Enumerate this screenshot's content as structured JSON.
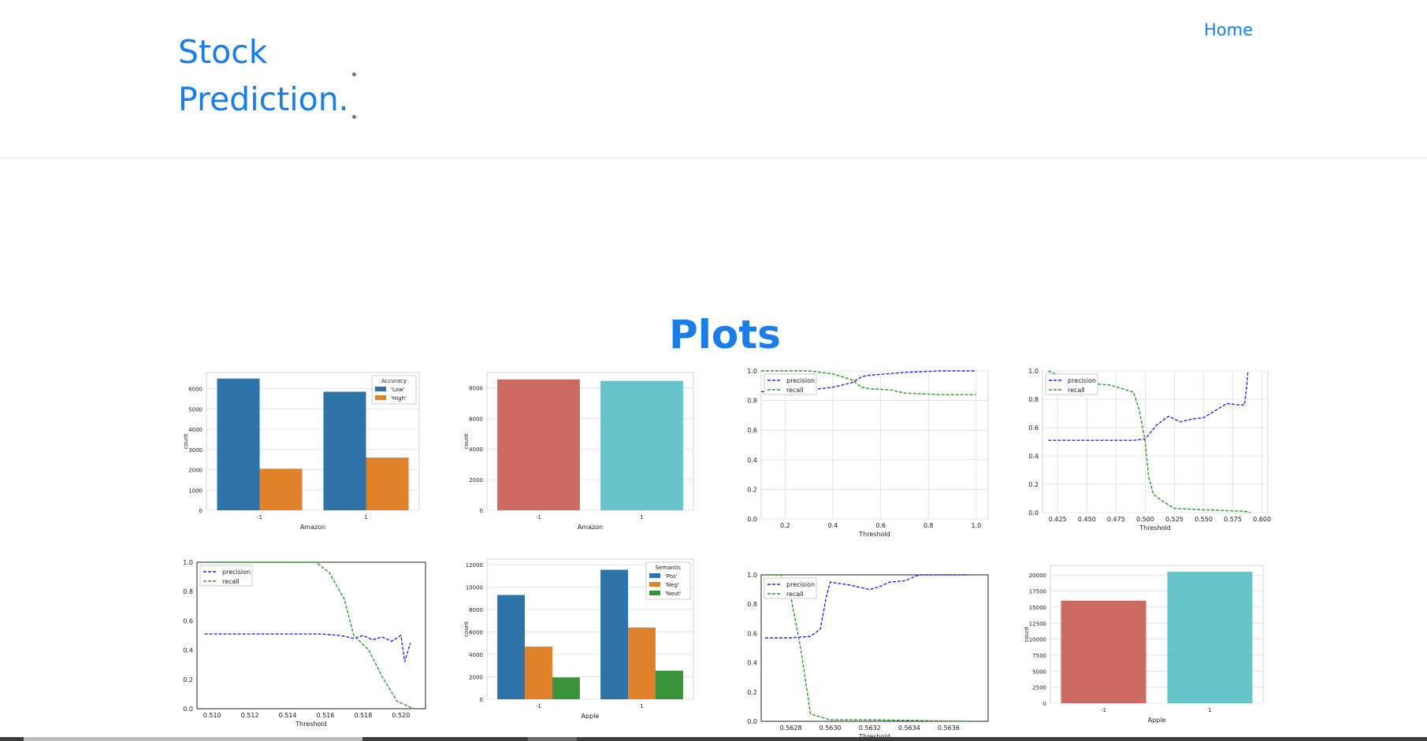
{
  "header": {
    "brand_line1": "Stock",
    "brand_line2": "Prediction.",
    "nav_home": "Home"
  },
  "main": {
    "title": "Plots"
  },
  "colors": {
    "accent": "#1a7de8",
    "blue": "#2f74a8",
    "orange": "#e2812b",
    "green": "#3a923a",
    "red": "#cc6a62",
    "teal": "#68c4cb"
  },
  "chart_data": [
    {
      "type": "bar",
      "xlabel": "Amazon",
      "ylabel": "count",
      "categories": [
        "-1",
        "1"
      ],
      "ylim": [
        0,
        6800
      ],
      "yticks": [
        0,
        1000,
        2000,
        3000,
        4000,
        5000,
        6000
      ],
      "legend": {
        "title": "Accuracy",
        "position": "top-right"
      },
      "series": [
        {
          "name": "'Low'",
          "color": "#2f74a8",
          "values": [
            6500,
            5850
          ]
        },
        {
          "name": "'High'",
          "color": "#e2812b",
          "values": [
            2050,
            2600
          ]
        }
      ]
    },
    {
      "type": "bar",
      "xlabel": "Amazon",
      "ylabel": "count",
      "categories": [
        "-1",
        "1"
      ],
      "ylim": [
        0,
        9000
      ],
      "yticks": [
        0,
        2000,
        4000,
        6000,
        8000
      ],
      "series": [
        {
          "values": [
            8550,
            8450
          ],
          "colors": [
            "#cc6a62",
            "#68c4cb"
          ]
        }
      ]
    },
    {
      "type": "line",
      "xlabel": "Threshold",
      "xlim": [
        0.1,
        1.05
      ],
      "ylim": [
        0,
        1.0
      ],
      "xticks": [
        0.2,
        0.4,
        0.6,
        0.8,
        1.0
      ],
      "yticks": [
        0.0,
        0.2,
        0.4,
        0.6,
        0.8,
        1.0
      ],
      "legend": {
        "position": "top-left"
      },
      "series": [
        {
          "name": "precision",
          "color": "#1f2ee0",
          "x": [
            0.1,
            0.2,
            0.3,
            0.4,
            0.48,
            0.52,
            0.55,
            0.7,
            0.85,
            1.0
          ],
          "y": [
            0.86,
            0.86,
            0.87,
            0.89,
            0.92,
            0.96,
            0.97,
            0.99,
            1.0,
            1.0
          ]
        },
        {
          "name": "recall",
          "color": "#2a9a2a",
          "x": [
            0.1,
            0.2,
            0.3,
            0.4,
            0.48,
            0.52,
            0.55,
            0.65,
            0.7,
            0.85,
            1.0
          ],
          "y": [
            1.0,
            1.0,
            1.0,
            0.98,
            0.94,
            0.89,
            0.88,
            0.87,
            0.85,
            0.84,
            0.84
          ]
        }
      ]
    },
    {
      "type": "line",
      "xlabel": "Threshold",
      "xlim": [
        0.412,
        0.605
      ],
      "ylim": [
        0,
        1.0
      ],
      "xticks": [
        0.425,
        0.45,
        0.475,
        0.5,
        0.525,
        0.55,
        0.575,
        0.6
      ],
      "yticks": [
        0.0,
        0.2,
        0.4,
        0.6,
        0.8,
        1.0
      ],
      "legend": {
        "position": "top-left"
      },
      "series": [
        {
          "name": "precision",
          "color": "#1f2ee0",
          "x": [
            0.417,
            0.45,
            0.49,
            0.5,
            0.51,
            0.52,
            0.53,
            0.54,
            0.55,
            0.56,
            0.57,
            0.58,
            0.585,
            0.587,
            0.588
          ],
          "y": [
            0.51,
            0.51,
            0.51,
            0.52,
            0.62,
            0.68,
            0.64,
            0.66,
            0.67,
            0.72,
            0.77,
            0.76,
            0.76,
            0.9,
            1.0
          ]
        },
        {
          "name": "recall",
          "color": "#2a9a2a",
          "x": [
            0.417,
            0.44,
            0.47,
            0.49,
            0.495,
            0.5,
            0.503,
            0.507,
            0.515,
            0.525,
            0.55,
            0.585,
            0.59
          ],
          "y": [
            1.0,
            0.92,
            0.9,
            0.85,
            0.72,
            0.5,
            0.25,
            0.13,
            0.08,
            0.03,
            0.02,
            0.01,
            0.0
          ]
        }
      ]
    },
    {
      "type": "line",
      "xlabel": "Threshold",
      "xlim": [
        0.5092,
        0.5213
      ],
      "ylim": [
        0,
        1.0
      ],
      "xticks": [
        0.51,
        0.512,
        0.514,
        0.516,
        0.518,
        0.52
      ],
      "yticks": [
        0.0,
        0.2,
        0.4,
        0.6,
        0.8,
        1.0
      ],
      "legend": {
        "position": "top-left"
      },
      "series": [
        {
          "name": "precision",
          "color": "#1f2ee0",
          "x": [
            0.5096,
            0.512,
            0.514,
            0.5158,
            0.5168,
            0.5175,
            0.518,
            0.5185,
            0.519,
            0.5195,
            0.52,
            0.5202,
            0.5205
          ],
          "y": [
            0.51,
            0.51,
            0.51,
            0.51,
            0.5,
            0.48,
            0.5,
            0.47,
            0.49,
            0.46,
            0.5,
            0.32,
            0.45
          ]
        },
        {
          "name": "recall",
          "color": "#2a9a2a",
          "x": [
            0.5096,
            0.5145,
            0.5155,
            0.5162,
            0.517,
            0.5175,
            0.5183,
            0.519,
            0.5198,
            0.5205,
            0.5207
          ],
          "y": [
            1.0,
            1.0,
            1.0,
            0.93,
            0.75,
            0.5,
            0.4,
            0.22,
            0.05,
            0.01,
            0.0
          ]
        }
      ]
    },
    {
      "type": "bar",
      "xlabel": "Apple",
      "ylabel": "count",
      "categories": [
        "-1",
        "1"
      ],
      "ylim": [
        0,
        12500
      ],
      "yticks": [
        0,
        2000,
        4000,
        6000,
        8000,
        10000,
        12000
      ],
      "legend": {
        "title": "Semantic",
        "position": "top-right"
      },
      "series": [
        {
          "name": "'Pos'",
          "color": "#2f74a8",
          "values": [
            9300,
            11550
          ]
        },
        {
          "name": "'Neg'",
          "color": "#e2812b",
          "values": [
            4700,
            6400
          ]
        },
        {
          "name": "'Neut'",
          "color": "#3a923a",
          "values": [
            1950,
            2550
          ]
        }
      ]
    },
    {
      "type": "line",
      "xlabel": "Threshold",
      "xlim": [
        0.56265,
        0.5638
      ],
      "ylim": [
        0,
        1.0
      ],
      "xticks": [
        0.5628,
        0.563,
        0.5632,
        0.5634,
        0.5636
      ],
      "yticks": [
        0.0,
        0.2,
        0.4,
        0.6,
        0.8,
        1.0
      ],
      "legend": {
        "position": "top-left"
      },
      "series": [
        {
          "name": "precision",
          "color": "#1f2ee0",
          "x": [
            0.56267,
            0.5628,
            0.5629,
            0.56295,
            0.56298,
            0.563,
            0.5631,
            0.5632,
            0.56325,
            0.5633,
            0.56338,
            0.56345,
            0.5637
          ],
          "y": [
            0.57,
            0.57,
            0.58,
            0.63,
            0.85,
            0.95,
            0.93,
            0.9,
            0.92,
            0.95,
            0.96,
            1.0,
            1.0
          ]
        },
        {
          "name": "recall",
          "color": "#2a9a2a",
          "x": [
            0.56267,
            0.56275,
            0.5628,
            0.56285,
            0.5629,
            0.563,
            0.5632,
            0.5637
          ],
          "y": [
            1.0,
            1.0,
            0.85,
            0.5,
            0.05,
            0.01,
            0.01,
            0.0
          ]
        }
      ]
    },
    {
      "type": "bar",
      "xlabel": "Apple",
      "ylabel": "count",
      "categories": [
        "-1",
        "1"
      ],
      "ylim": [
        0,
        21500
      ],
      "yticks": [
        0,
        2500,
        5000,
        7500,
        10000,
        12500,
        15000,
        17500,
        20000
      ],
      "series": [
        {
          "values": [
            16000,
            20500
          ],
          "colors": [
            "#cc6a62",
            "#68c4cb"
          ]
        }
      ]
    }
  ]
}
